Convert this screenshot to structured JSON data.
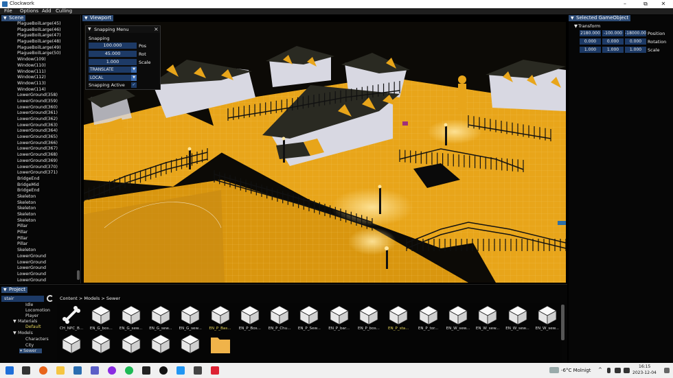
{
  "window": {
    "title": "Clockwork",
    "minimize": "–",
    "maximize": "⧉",
    "close": "✕"
  },
  "menu": [
    "File",
    "Options",
    "Add",
    "Culling"
  ],
  "panels": {
    "scene": "Scene",
    "viewport": "Viewport",
    "inspector": "Selected GameObject",
    "project": "Project"
  },
  "scene_items": [
    "PlagueBoilLarge(45)",
    "PlagueBoilLarge(46)",
    "PlagueBoilLarge(47)",
    "PlagueBoilLarge(48)",
    "PlagueBoilLarge(49)",
    "PlagueBoilLarge(50)",
    "Window(109)",
    "Window(110)",
    "Window(111)",
    "Window(112)",
    "Window(113)",
    "Window(114)",
    "LowerGround(358)",
    "LowerGround(359)",
    "LowerGround(360)",
    "LowerGround(361)",
    "LowerGround(362)",
    "LowerGround(363)",
    "LowerGround(364)",
    "LowerGround(365)",
    "LowerGround(366)",
    "LowerGround(367)",
    "LowerGround(368)",
    "LowerGround(369)",
    "LowerGround(370)",
    "LowerGround(371)",
    "BridgeEnd",
    "BridgeMid",
    "BridgeEnd",
    "Skeleton",
    "Skeleton",
    "Skeleton",
    "Skeleton",
    "Skeleton",
    "Pillar",
    "Pillar",
    "Pillar",
    "Pillar",
    "Skeleton",
    "LowerGround",
    "LowerGround",
    "LowerGround",
    "LowerGround",
    "LowerGround"
  ],
  "snapping": {
    "title": "Snapping Menu",
    "section": "Snapping",
    "pos_value": "100.000",
    "pos_label": "Pos",
    "rot_value": "45.000",
    "rot_label": "Rot",
    "scale_value": "1.000",
    "scale_label": "Scale",
    "mode": "TRANSLATE",
    "space": "LOCAL",
    "active_label": "Snapping Active",
    "active_check": "✓"
  },
  "inspector": {
    "section": "Transform",
    "position": [
      "2180.000",
      "-100.000",
      "-18000.00"
    ],
    "rotation": [
      "0.000",
      "0.000",
      "0.000"
    ],
    "scale": [
      "1.000",
      "1.000",
      "1.000"
    ],
    "position_label": "Position",
    "rotation_label": "Rotation",
    "scale_label": "Scale"
  },
  "project": {
    "search_value": "stair",
    "breadcrumb": "Content > Models > Sewer",
    "tree": [
      "Idle",
      "Locomotion",
      "Player",
      "Materials",
      "Default",
      "Models",
      "Characters",
      "City",
      "Sewer"
    ],
    "assets": [
      "CH_NPC_B...",
      "EN_G_bos...",
      "EN_G_sew...",
      "EN_G_sew...",
      "EN_G_sew...",
      "EN_P_Bas...",
      "EN_P_Bos...",
      "EN_P_Chu...",
      "EN_P_Sew...",
      "EN_P_bar...",
      "EN_P_bos...",
      "EN_P_sta...",
      "EN_P_tor...",
      "EN_W_sew...",
      "EN_W_sew...",
      "EN_W_sew...",
      "EN_W_sew..."
    ],
    "highlighted_assets": [
      5,
      11
    ]
  },
  "taskbar": {
    "weather": "-6°C Molnigt",
    "time": "16:15",
    "date": "2023-12-04"
  },
  "colors": {
    "accent": "#2c4a74",
    "field": "#1d3a66",
    "ground": "#e8a51a",
    "roof": "#2a2a22",
    "wall": "#d8d8e2",
    "folder": "#f0b34a"
  }
}
